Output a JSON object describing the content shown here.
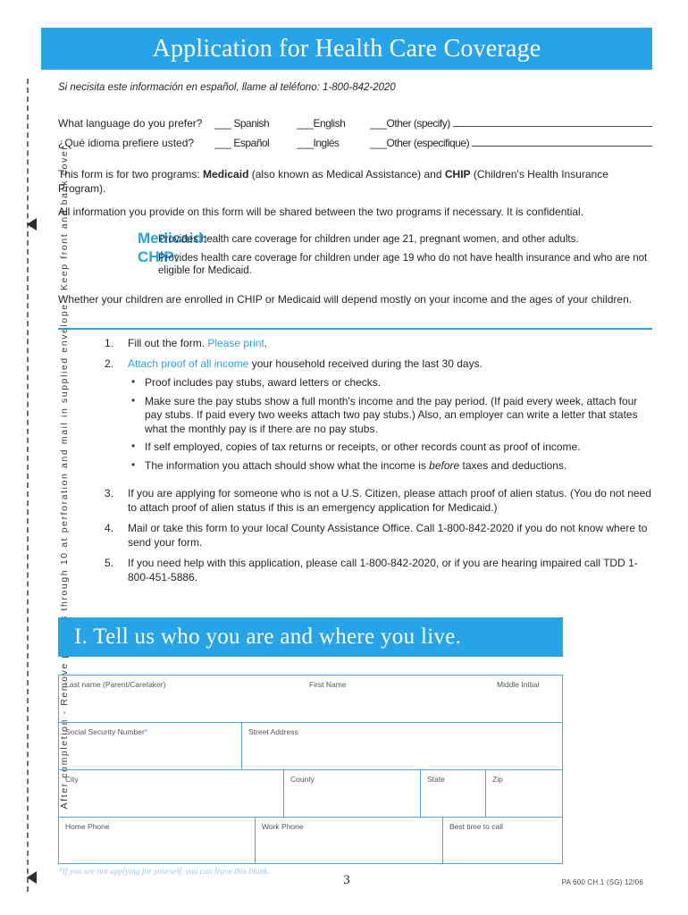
{
  "header": {
    "title": "Application for Health Care Coverage"
  },
  "spanish_note": "Si necisita este información en español, llame al teléfono: 1-800-842-2020",
  "language": {
    "rows": [
      {
        "question": "What language do you prefer?",
        "opt1": "___ Spanish",
        "opt2": "___English",
        "opt3": "___Other (specify)"
      },
      {
        "question": "¿Qué idioma prefiere usted?",
        "opt1": "___ Español",
        "opt2": "___Inglés",
        "opt3": "___Other (especifique)"
      }
    ]
  },
  "intro": {
    "programs_pre": "This form is for two programs: ",
    "programs_b1": "Medicaid",
    "programs_mid": " (also known as Medical Assistance) and ",
    "programs_b2": "CHIP",
    "programs_post": " (Children's Health Insurance Program).",
    "confidential": "All information you provide on this form will be shared between the two programs if necessary. It is confidential.",
    "whether": "Whether your children are enrolled in CHIP or Medicaid will depend mostly on your income and the ages of your children."
  },
  "programs": [
    {
      "name": "Medicaid:",
      "description": "Provides health care coverage for children under age 21, pregnant women, and other adults."
    },
    {
      "name": "CHIP:",
      "description": "Provides health care coverage for children under age 19 who do not have health insurance and who are not eligible for Medicaid."
    }
  ],
  "steps": [
    {
      "num": "1.",
      "pre": "Fill out the form. ",
      "accent": "Please print",
      "post": ".",
      "bullets": []
    },
    {
      "num": "2.",
      "pre": "",
      "accent": "Attach proof of all income",
      "post": " your household received during the last 30 days.",
      "bullets": [
        "Proof includes pay stubs, award letters or checks.",
        "Make sure the pay stubs show a full month's income and the pay period. (If paid every week, attach four pay stubs. If paid every two weeks attach two pay stubs.) Also, an employer can write a letter that states what the monthly pay is if there are no pay stubs.",
        "If self employed, copies of tax returns or receipts, or other records count as proof of income."
      ],
      "bullet_last_pre": "The information you attach should show what the income is ",
      "bullet_last_it": "before",
      "bullet_last_post": " taxes and deductions."
    },
    {
      "num": "3.",
      "text": "If you are applying for someone who is not a U.S. Citizen, please attach proof of alien status. (You do not need to attach proof of alien status if this is an emergency application for Medicaid.)"
    },
    {
      "num": "4.",
      "text": "Mail or take this form to your local County Assistance Office. Call 1-800-842-2020 if you do not know where to send your form."
    },
    {
      "num": "5.",
      "text": "If you need help with this application, please call 1-800-842-2020, or if you are hearing impaired call TDD 1-800-451-5886."
    }
  ],
  "section": {
    "heading": "I. Tell us who you are and where you live."
  },
  "form_fields": {
    "last_name": "Last name (Parent/Caretaker)",
    "first_name": "First Name",
    "middle_initial": "Middle Initial",
    "ssn": "Social Security Number",
    "ssn_required_mark": "*",
    "street_address": "Street Address",
    "city": "City",
    "county": "County",
    "state": "State",
    "zip": "Zip",
    "home_phone": "Home Phone",
    "work_phone": "Work Phone",
    "best_time": "Best time to call"
  },
  "footer": {
    "footnote": "*If you are not applying for yourself, you can leave this blank.",
    "page_number": "3",
    "form_code": "PA 600 CH.1 (SG)   12/06"
  },
  "side_rail": {
    "text": "After completion - Remove pages 3 through 10 at perforation and mail in supplied envelope - Keep front and back cover."
  },
  "colors": {
    "accent_blue": "#27a3e8",
    "table_border": "#4ba8e2",
    "footnote_blue": "#9cc9e8"
  }
}
